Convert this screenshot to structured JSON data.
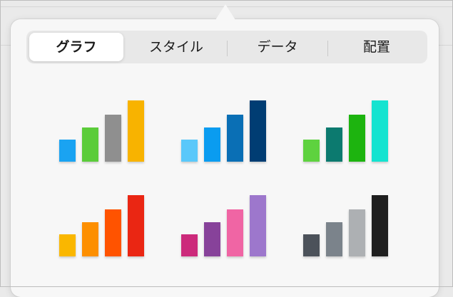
{
  "tabs": [
    {
      "label": "グラフ",
      "active": true
    },
    {
      "label": "スタイル",
      "active": false
    },
    {
      "label": "データ",
      "active": false
    },
    {
      "label": "配置",
      "active": false
    }
  ],
  "chart_styles": [
    {
      "name": "multicolor",
      "colors": [
        "#1aa3f2",
        "#5bcc3a",
        "#8f8f8f",
        "#f8b300"
      ]
    },
    {
      "name": "blues",
      "colors": [
        "#5ac8fa",
        "#0a9cf0",
        "#0a6fb5",
        "#003d73"
      ]
    },
    {
      "name": "greens",
      "colors": [
        "#5ed23f",
        "#0c7a6f",
        "#1db40f",
        "#14e3d0"
      ]
    },
    {
      "name": "oranges",
      "colors": [
        "#fab700",
        "#fd8f00",
        "#ff5300",
        "#ea2613"
      ]
    },
    {
      "name": "pinks-purples",
      "colors": [
        "#cc2a7b",
        "#87429a",
        "#f065a4",
        "#9d77cc"
      ]
    },
    {
      "name": "grays",
      "colors": [
        "#4c525a",
        "#7b838b",
        "#adb0b3",
        "#1e1e1e"
      ]
    }
  ],
  "bar_levels": [
    0.36,
    0.56,
    0.77,
    1.0
  ]
}
